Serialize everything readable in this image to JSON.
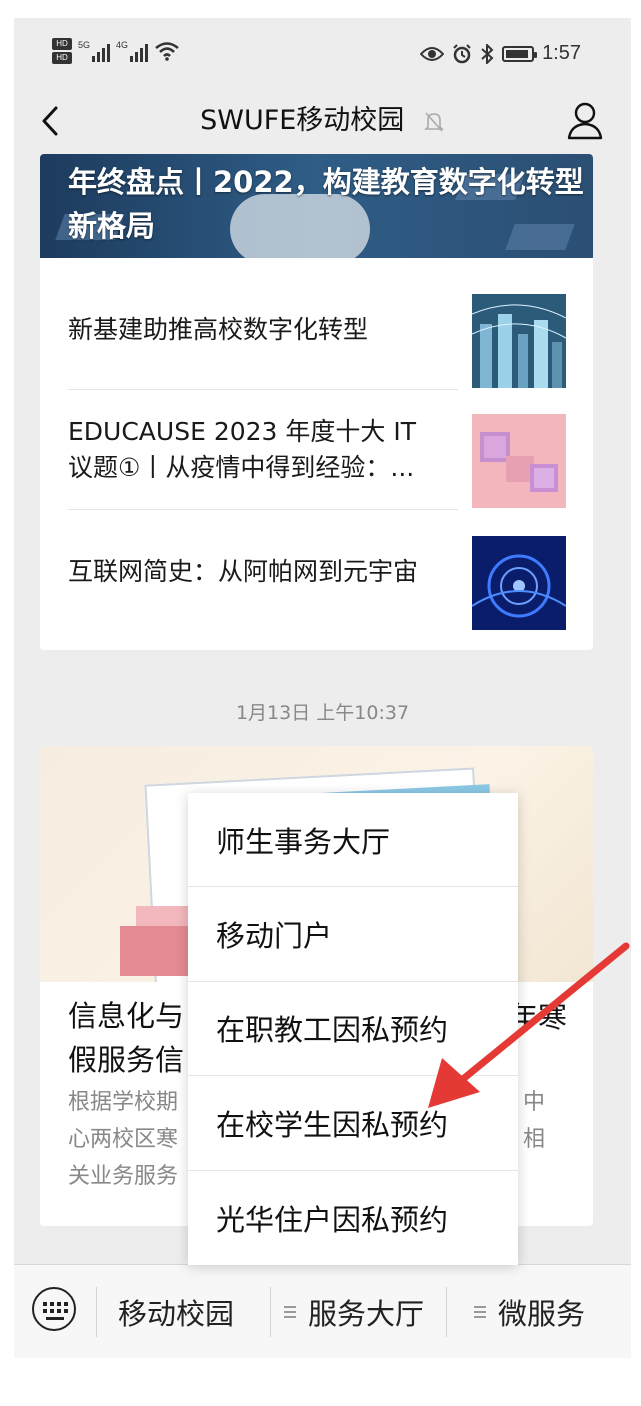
{
  "status_bar": {
    "hd_badges": [
      "HD",
      "HD"
    ],
    "signal_1_label": "5G",
    "signal_2_label": "4G",
    "time": "1:57"
  },
  "navbar": {
    "title": "SWUFE移动校园",
    "back_icon": "chevron-left-icon",
    "mute_icon": "bell-muted-icon",
    "profile_icon": "person-icon"
  },
  "article_card": {
    "banner_title": "年终盘点丨2022，构建教育数字化转型新格局",
    "items": [
      {
        "title": "新基建助推高校数字化转型",
        "thumb": "city-network-image"
      },
      {
        "title": "EDUCAUSE 2023 年度十大 IT 议题①丨从疫情中得到经验：...",
        "thumb": "pink-cubes-image"
      },
      {
        "title": "互联网简史：从阿帕网到元宇宙",
        "thumb": "blue-tech-image"
      }
    ]
  },
  "timestamp": "1月13日 上午10:37",
  "notice_card": {
    "title_left_1": "信息化与",
    "title_left_2": "假服务信",
    "title_right": "年寒",
    "desc_left_1": "根据学校期",
    "desc_left_2": "心两校区寒",
    "desc_left_3": "关业务服务",
    "desc_right_1": "中",
    "desc_right_2": "相"
  },
  "popup_menu": {
    "items": [
      "师生事务大厅",
      "移动门户",
      "在职教工因私预约",
      "在校学生因私预约",
      "光华住户因私预约"
    ]
  },
  "bottom_bar": {
    "keyboard_icon": "keyboard-icon",
    "tabs": [
      "移动校园",
      "服务大厅",
      "微服务"
    ],
    "menu_icon": "menu-lines-icon"
  },
  "colors": {
    "arrow": "#e53935",
    "background": "#ededed",
    "card": "#ffffff"
  }
}
